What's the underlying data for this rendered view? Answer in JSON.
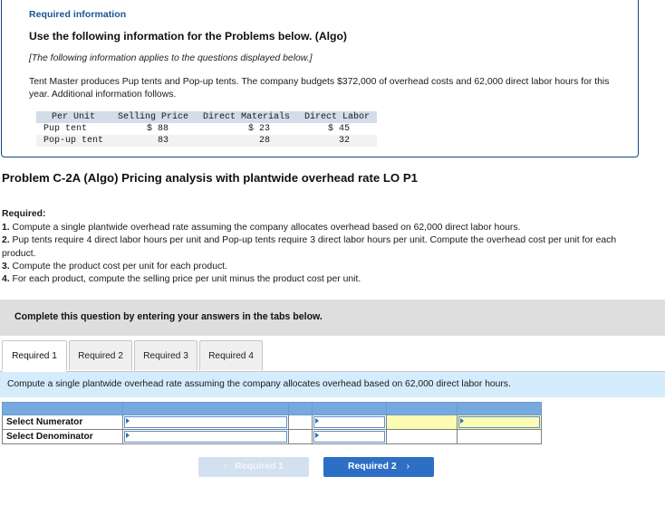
{
  "required_info": {
    "label": "Required information",
    "heading": "Use the following information for the Problems below. (Algo)",
    "applies_note": "[The following information applies to the questions displayed below.]",
    "body": "Tent Master produces Pup tents and Pop-up tents. The company budgets $372,000 of overhead costs and 62,000 direct labor hours for this year. Additional information follows.",
    "table": {
      "headers": [
        "Per Unit",
        "Selling Price",
        "Direct Materials",
        "Direct Labor"
      ],
      "rows": [
        {
          "label": "Pup tent",
          "selling_price": "$ 88",
          "direct_materials": "$ 23",
          "direct_labor": "$ 45"
        },
        {
          "label": "Pop-up tent",
          "selling_price": "83",
          "direct_materials": "28",
          "direct_labor": "32"
        }
      ]
    }
  },
  "problem": {
    "title": "Problem C-2A (Algo) Pricing analysis with plantwide overhead rate LO P1",
    "required_heading": "Required:",
    "items": [
      {
        "num": "1.",
        "text": " Compute a single plantwide overhead rate assuming the company allocates overhead based on 62,000 direct labor hours."
      },
      {
        "num": "2.",
        "text": " Pup tents require 4 direct labor hours per unit and Pop-up tents require 3 direct labor hours per unit. Compute the overhead cost per unit for each product."
      },
      {
        "num": "3.",
        "text": " Compute the product cost per unit for each product."
      },
      {
        "num": "4.",
        "text": " For each product, compute the selling price per unit minus the product cost per unit."
      }
    ]
  },
  "complete_bar": {
    "text": "Complete this question by entering your answers in the tabs below."
  },
  "tabs": [
    {
      "label": "Required 1",
      "active": true
    },
    {
      "label": "Required 2",
      "active": false
    },
    {
      "label": "Required 3",
      "active": false
    },
    {
      "label": "Required 4",
      "active": false
    }
  ],
  "instruction": {
    "text": "Compute a single plantwide overhead rate assuming the company allocates overhead based on 62,000 direct labor hours."
  },
  "answer_table": {
    "rows": [
      {
        "label": "Select Numerator"
      },
      {
        "label": "Select Denominator"
      }
    ]
  },
  "nav": {
    "prev_label": "Required 1",
    "prev_chevron": "‹",
    "next_label": "Required 2",
    "next_chevron": "›"
  },
  "colors": {
    "panel_border": "#17457f",
    "info_label": "#1a5490",
    "table_header_blue": "#76a9e0",
    "instruction_blue": "#d4ecfb",
    "complete_gray": "#dedede",
    "input_highlight_yellow": "#fbfbb3",
    "button_active_blue": "#2d6fc4",
    "button_disabled_blue": "#d3e0f0",
    "mono_header_gray": "#d3dce8"
  }
}
